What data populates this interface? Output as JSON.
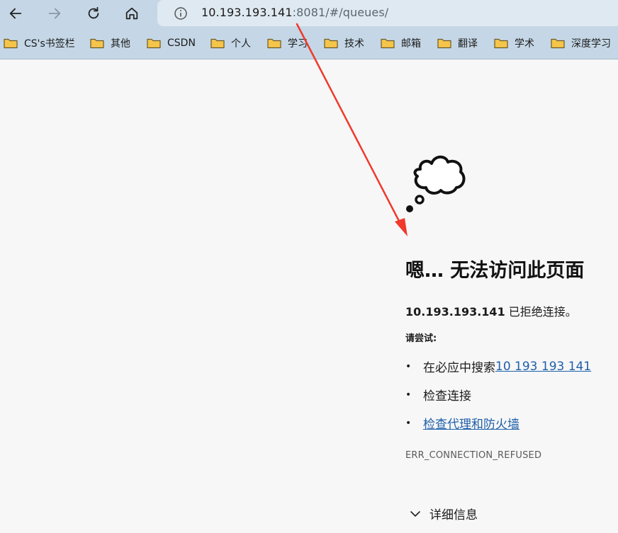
{
  "browser": {
    "url_host": "10.193.193.141",
    "url_rest": ":8081/#/queues/",
    "bookmarks": [
      {
        "label": "CS's书签栏"
      },
      {
        "label": "其他"
      },
      {
        "label": "CSDN"
      },
      {
        "label": "个人"
      },
      {
        "label": "学习"
      },
      {
        "label": "技术"
      },
      {
        "label": "邮箱"
      },
      {
        "label": "翻译"
      },
      {
        "label": "学术"
      },
      {
        "label": "深度学习"
      }
    ]
  },
  "error_page": {
    "title": "嗯… 无法访问此页面",
    "host": "10.193.193.141",
    "refused_text": " 已拒绝连接。",
    "try_label": "请尝试:",
    "suggestion_search_prefix": "在必应中搜索 ",
    "suggestion_search_link": "10 193 193 141",
    "suggestion_check_connection": "检查连接",
    "suggestion_proxy_firewall": "检查代理和防火墙",
    "error_code": "ERR_CONNECTION_REFUSED",
    "details_label": "详细信息"
  },
  "colors": {
    "toolbar_bg": "#c5d7e6",
    "address_bg": "#dfe9f1",
    "page_bg": "#f7f7f8",
    "link": "#1f5fa8",
    "annotation_arrow": "#f03a2a",
    "folder": "#f5c54a"
  }
}
